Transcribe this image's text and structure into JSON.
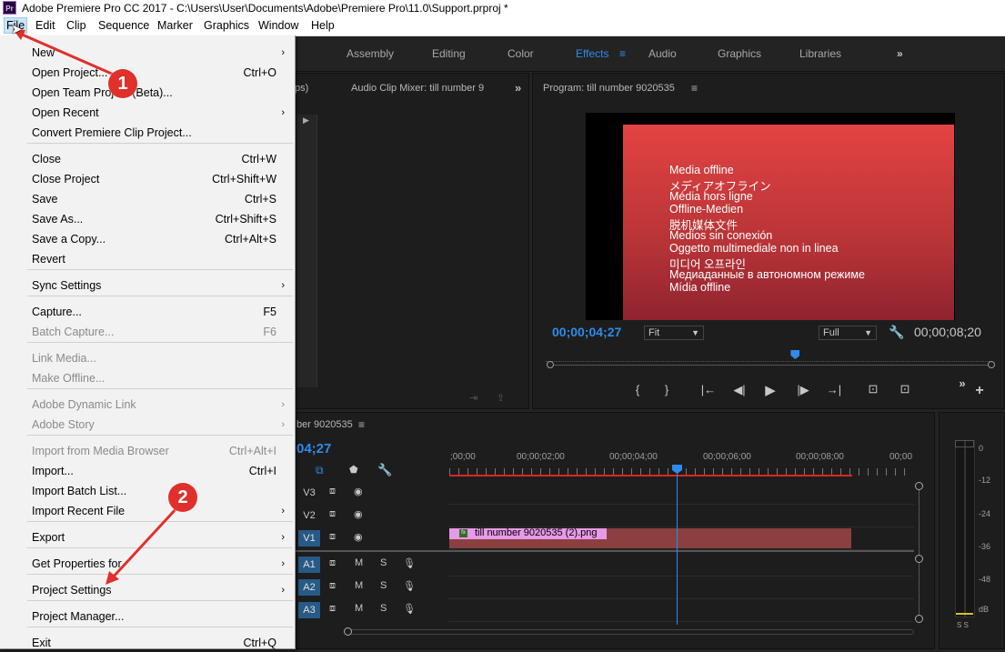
{
  "window": {
    "title": "Adobe Premiere Pro CC 2017 - C:\\Users\\User\\Documents\\Adobe\\Premiere Pro\\11.0\\Support.prproj *",
    "app_icon": "Pr"
  },
  "menubar": [
    "File",
    "Edit",
    "Clip",
    "Sequence",
    "Marker",
    "Graphics",
    "Window",
    "Help"
  ],
  "workspaces": {
    "items": [
      "Assembly",
      "Editing",
      "Color",
      "Effects",
      "Audio",
      "Graphics",
      "Libraries"
    ],
    "active": "Effects",
    "overflow": "»"
  },
  "source_panel": {
    "partial_tab": "ps)",
    "tab": "Audio Clip Mixer: till number 9",
    "overflow": "»"
  },
  "program": {
    "title": "Program: till number 9020535",
    "menu": "≡",
    "offline_lines": [
      "Media offline",
      "メディアオフライン",
      "Média hors ligne",
      "Offline-Medien",
      "脱机媒体文件",
      "Medios sin conexión",
      "Oggetto multimediale non in linea",
      "미디어 오프라인",
      "Медиаданные в автономном режиме",
      "Mídia offline"
    ],
    "timecode": "00;00;04;27",
    "zoom": "Fit",
    "quality": "Full",
    "duration": "00;00;08;20",
    "playhead_fraction": 0.56,
    "controls": [
      "{",
      "}",
      "|←",
      "◀|",
      "▶",
      "|▶",
      "→|",
      "⊡",
      "⊡",
      "»",
      "+"
    ]
  },
  "timeline": {
    "title": "ber 9020535",
    "menu": "≡",
    "timecode": "04;27",
    "ruler": [
      ";00;00",
      "00;00;02;00",
      "00;00;04;00",
      "00;00;06;00",
      "00;00;08;00",
      "00;00"
    ],
    "tracks": [
      {
        "name": "V3",
        "kind": "video",
        "targeted": false
      },
      {
        "name": "V2",
        "kind": "video",
        "targeted": false
      },
      {
        "name": "V1",
        "kind": "video",
        "targeted": true
      },
      {
        "name": "A1",
        "kind": "audio",
        "targeted": true
      },
      {
        "name": "A2",
        "kind": "audio",
        "targeted": true
      },
      {
        "name": "A3",
        "kind": "audio",
        "targeted": true
      }
    ],
    "mute_label": "M",
    "solo_label": "S",
    "clip": {
      "fx": "fx",
      "label": "till number 9020535 (2).png"
    }
  },
  "meter": {
    "labels": [
      "0",
      "-12",
      "-24",
      "-36",
      "-48",
      "dB"
    ],
    "footer": "S S"
  },
  "file_menu": {
    "items": [
      {
        "label": "New",
        "submenu": true
      },
      {
        "label": "Open Project...",
        "shortcut": "Ctrl+O"
      },
      {
        "label": "Open Team Project (Beta)..."
      },
      {
        "label": "Open Recent",
        "submenu": true
      },
      {
        "label": "Convert Premiere Clip Project..."
      },
      {
        "sep": true
      },
      {
        "label": "Close",
        "shortcut": "Ctrl+W"
      },
      {
        "label": "Close Project",
        "shortcut": "Ctrl+Shift+W"
      },
      {
        "label": "Save",
        "shortcut": "Ctrl+S"
      },
      {
        "label": "Save As...",
        "shortcut": "Ctrl+Shift+S"
      },
      {
        "label": "Save a Copy...",
        "shortcut": "Ctrl+Alt+S"
      },
      {
        "label": "Revert"
      },
      {
        "sep": true
      },
      {
        "label": "Sync Settings",
        "submenu": true
      },
      {
        "sep": true
      },
      {
        "label": "Capture...",
        "shortcut": "F5"
      },
      {
        "label": "Batch Capture...",
        "shortcut": "F6",
        "disabled": true
      },
      {
        "sep": true
      },
      {
        "label": "Link Media...",
        "disabled": true
      },
      {
        "label": "Make Offline...",
        "disabled": true
      },
      {
        "sep": true
      },
      {
        "label": "Adobe Dynamic Link",
        "submenu": true,
        "disabled": true
      },
      {
        "label": "Adobe Story",
        "submenu": true,
        "disabled": true
      },
      {
        "sep": true
      },
      {
        "label": "Import from Media Browser",
        "shortcut": "Ctrl+Alt+I",
        "disabled": true
      },
      {
        "label": "Import...",
        "shortcut": "Ctrl+I"
      },
      {
        "label": "Import Batch List..."
      },
      {
        "label": "Import Recent File",
        "submenu": true
      },
      {
        "sep": true
      },
      {
        "label": "Export",
        "submenu": true
      },
      {
        "sep": true
      },
      {
        "label": "Get Properties for",
        "submenu": true
      },
      {
        "sep": true
      },
      {
        "label": "Project Settings",
        "submenu": true
      },
      {
        "sep": true
      },
      {
        "label": "Project Manager..."
      },
      {
        "sep": true
      },
      {
        "label": "Exit",
        "shortcut": "Ctrl+Q"
      }
    ]
  },
  "annotations": [
    {
      "number": "1"
    },
    {
      "number": "2"
    }
  ],
  "colors": {
    "accent": "#2d8ceb",
    "badge": "#e0302c",
    "offline_red": "#c23a3c",
    "clip": "#8a4040",
    "clip_label": "#e79ae7"
  }
}
